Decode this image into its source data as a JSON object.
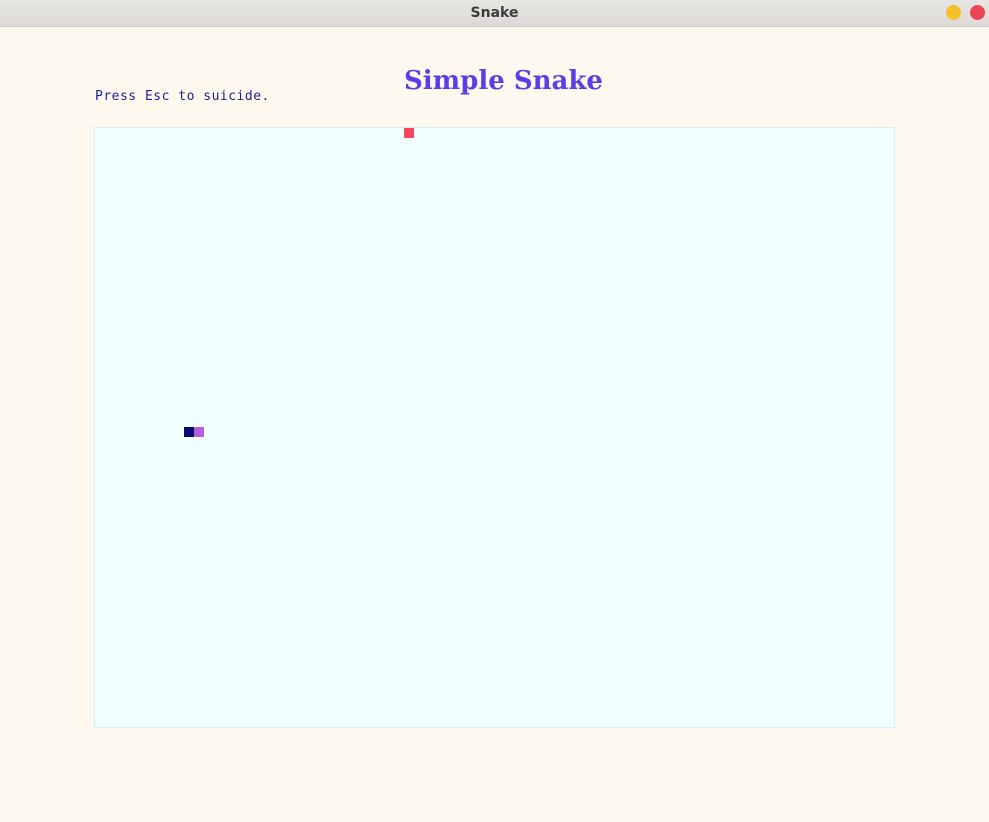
{
  "window": {
    "title": "Snake"
  },
  "game": {
    "title": "Simple Snake",
    "hint": "Press Esc to suicide."
  },
  "colors": {
    "background": "#fef9ee",
    "board": "#f0ffff",
    "title": "#5a3ee6",
    "hint": "#1f1f88",
    "food": "#f5485f",
    "snake_head": "#0a0a72",
    "snake_body": "#b55fe0"
  },
  "icons": {
    "minimize": "minimize-icon",
    "close": "close-icon"
  }
}
